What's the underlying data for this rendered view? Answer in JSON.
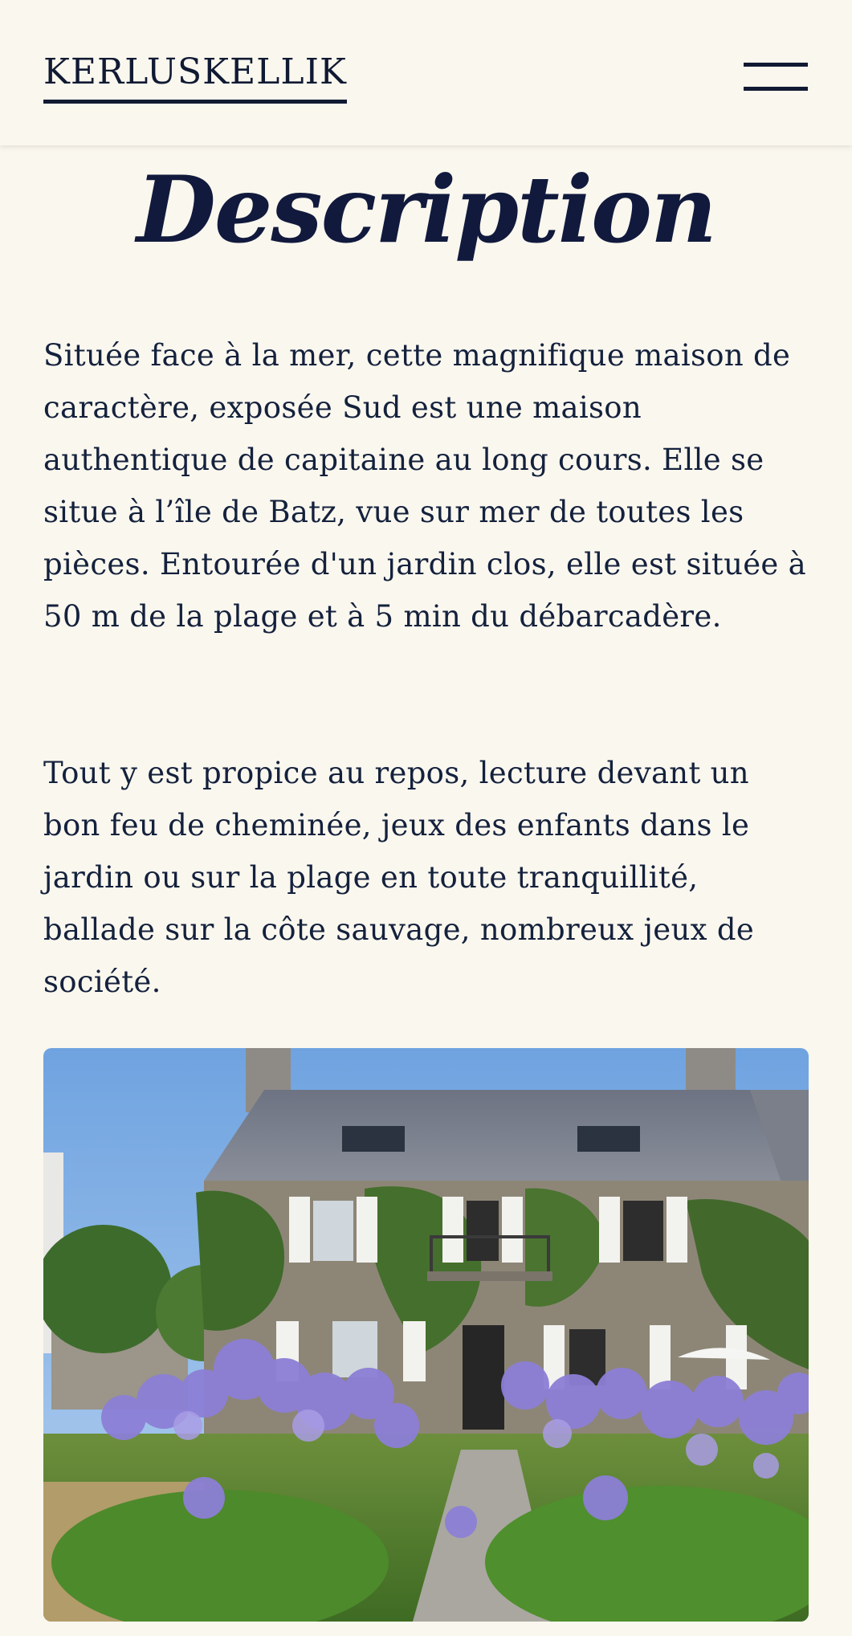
{
  "header": {
    "brand": "KERLUSKELLIK",
    "menu_icon": "hamburger-menu-icon"
  },
  "main": {
    "title": "Description",
    "paragraphs": [
      "Située face à la mer, cette magnifique maison de caractère, exposée Sud est une maison authentique de capitaine au long cours. Elle se situe à l’île de Batz, vue sur mer de toutes les pièces. Entourée d'un jardin clos, elle est située à 50 m de la plage et à 5 min du débarcadère.",
      "Tout y est propice au repos, lecture devant un bon feu de cheminée, jeux des enfants dans le jardin ou sur la plage en toute tranquillité, ballade sur la côte sauvage, nombreux jeux de société."
    ]
  },
  "colors": {
    "background": "#faf7ee",
    "text": "#14213d",
    "heading": "#111a3d"
  }
}
